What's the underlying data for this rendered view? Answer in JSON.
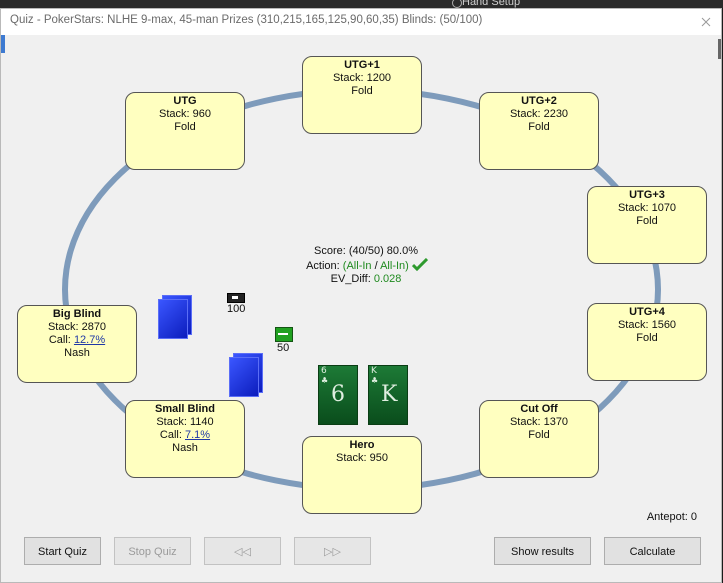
{
  "topbar": {
    "text": "Hand Setup"
  },
  "window": {
    "title": "Quiz - PokerStars: NLHE 9-max, 45-man Prizes (310,215,165,125,90,60,35) Blinds: (50/100)"
  },
  "seats": {
    "utg1": {
      "name": "UTG+1",
      "stack_label": "Stack:",
      "stack": "1200",
      "action": "Fold"
    },
    "utg2": {
      "name": "UTG+2",
      "stack_label": "Stack:",
      "stack": "2230",
      "action": "Fold"
    },
    "utg": {
      "name": "UTG",
      "stack_label": "Stack:",
      "stack": "960",
      "action": "Fold"
    },
    "utg3": {
      "name": "UTG+3",
      "stack_label": "Stack:",
      "stack": "1070",
      "action": "Fold"
    },
    "utg4": {
      "name": "UTG+4",
      "stack_label": "Stack:",
      "stack": "1560",
      "action": "Fold"
    },
    "big_blind": {
      "name": "Big Blind",
      "stack_label": "Stack:",
      "stack": "2870",
      "call_label": "Call:",
      "call": "12.7%",
      "action": "Nash"
    },
    "small_blind": {
      "name": "Small Blind",
      "stack_label": "Stack:",
      "stack": "1140",
      "call_label": "Call:",
      "call": "7.1%",
      "action": "Nash"
    },
    "cut_off": {
      "name": "Cut Off",
      "stack_label": "Stack:",
      "stack": "1370",
      "action": "Fold"
    },
    "hero": {
      "name": "Hero",
      "stack_label": "Stack:",
      "stack": "950"
    }
  },
  "info": {
    "score_label": "Score:",
    "score": "(40/50) 80.0%",
    "action_label": "Action:",
    "action_open": "(",
    "action_a": "All-In",
    "action_sep": " / ",
    "action_b": "All-In",
    "action_close": ")",
    "ev_label": "EV_Diff:",
    "ev_value": "0.028",
    "check_icon": "checkmark-icon"
  },
  "bets": {
    "bb": "100",
    "sb": "50"
  },
  "hole_cards": [
    {
      "rank": "6",
      "suit": "♣"
    },
    {
      "rank": "K",
      "suit": "♣"
    }
  ],
  "antepot": "Antepot: 0",
  "buttons": {
    "start": "Start Quiz",
    "stop": "Stop Quiz",
    "prev": "◁◁",
    "next": "▷▷",
    "show": "Show results",
    "calc": "Calculate"
  },
  "colors": {
    "seat_bg": "#ffffc0",
    "ring": "#7e9bbb",
    "card_green": "#1d7a36",
    "card_back": "#1b2bd6"
  }
}
